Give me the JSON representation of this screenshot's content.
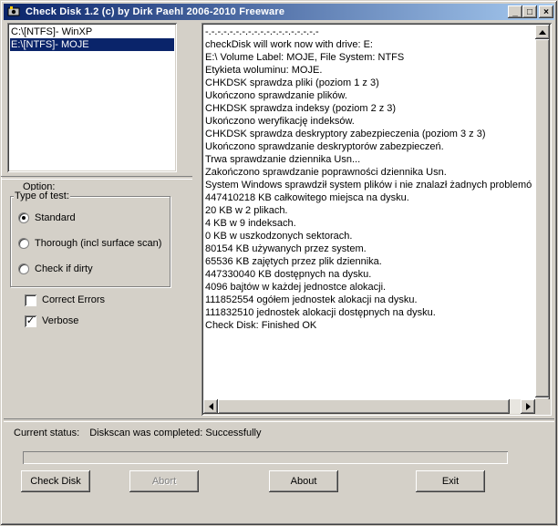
{
  "window": {
    "title": "Check Disk 1.2  (c) by Dirk Paehl  2006-2010 Freeware",
    "minimize_label": "_",
    "maximize_label": "□",
    "close_label": "×"
  },
  "drives": [
    {
      "label": "C:\\[NTFS]- WinXP",
      "selected": false
    },
    {
      "label": "E:\\[NTFS]- MOJE",
      "selected": true
    }
  ],
  "options": {
    "option_label": "Option:",
    "group_title": "Type of test:",
    "radios": [
      {
        "label": "Standard",
        "checked": true
      },
      {
        "label": "Thorough (incl surface scan)",
        "checked": false
      },
      {
        "label": "Check if dirty",
        "checked": false
      }
    ],
    "checkboxes": [
      {
        "label": "Correct Errors",
        "checked": false,
        "mark": ""
      },
      {
        "label": "Verbose",
        "checked": true,
        "mark": "✓"
      }
    ]
  },
  "log": {
    "lines": [
      "-.-.-.-.-.-.-.-.-.-.-.-.-.-.-.-.-.-.-",
      "checkDisk will work now with drive: E:",
      "E:\\ Volume Label: MOJE, File System: NTFS",
      "Etykieta woluminu: MOJE.",
      "CHKDSK sprawdza pliki (poziom 1 z 3)",
      "Ukończono sprawdzanie plików.",
      "CHKDSK sprawdza indeksy (poziom 2 z 3)",
      "Ukończono weryfikację indeksów.",
      "CHKDSK sprawdza deskryptory zabezpieczenia (poziom 3 z 3)",
      "Ukończono sprawdzanie deskryptorów zabezpieczeń.",
      "Trwa sprawdzanie dziennika Usn...",
      "Zakończono sprawdzanie poprawności dziennika Usn.",
      "System Windows sprawdził system plików i nie znalazł żadnych problemó",
      "447410218 KB całkowitego miejsca na dysku.",
      "20 KB w 2 plikach.",
      "4 KB w 9 indeksach.",
      "0 KB w uszkodzonych sektorach.",
      "80154 KB używanych przez system.",
      "65536 KB zajętych przez plik dziennika.",
      "447330040 KB dostępnych na dysku.",
      "4096 bajtów w każdej jednostce alokacji.",
      "111852554 ogółem jednostek alokacji na dysku.",
      "111832510 jednostek alokacji dostępnych na dysku.",
      "Check Disk: Finished OK"
    ]
  },
  "status": {
    "label": "Current status:",
    "value": "Diskscan was completed: Successfully",
    "progress": 0
  },
  "buttons": {
    "check_disk": "Check Disk",
    "abort": "Abort",
    "about": "About",
    "exit": "Exit"
  }
}
